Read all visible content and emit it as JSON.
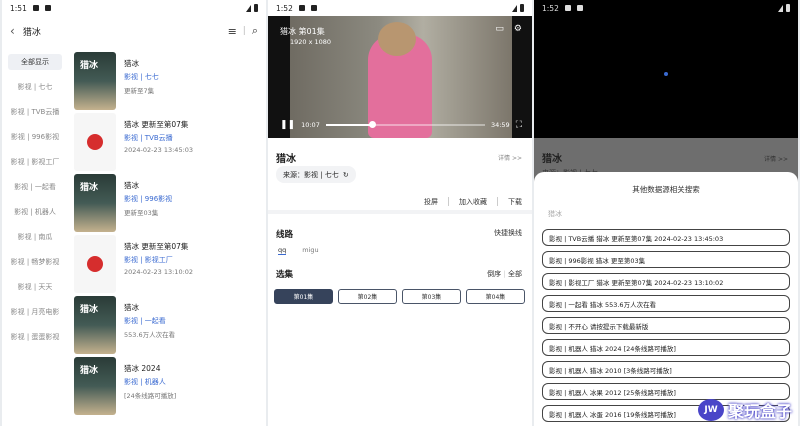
{
  "panel1": {
    "status_time": "1:51",
    "title": "猎冰",
    "sidebar": [
      "全部显示",
      "影视 | 七七",
      "影视 | TVB云播",
      "影视 | 996影视",
      "影视 | 影视工厂",
      "影视 | 一起看",
      "影视 | 机器人",
      "影视 | 南瓜",
      "影视 | 畅梦影视",
      "影视 | 天天",
      "影视 | 月亮电影",
      "影视 | 蛋蛋影视"
    ],
    "results": [
      {
        "title": "猎冰",
        "source": "影视 | 七七",
        "desc": "更新至7集",
        "poster": "movie"
      },
      {
        "title": "猎冰 更新至第07集",
        "source": "影视 | TVB云播",
        "desc": "2024-02-23 13:45:03",
        "poster": "logo"
      },
      {
        "title": "猎冰",
        "source": "影视 | 996影视",
        "desc": "更新至03集",
        "poster": "movie"
      },
      {
        "title": "猎冰 更新至第07集",
        "source": "影视 | 影视工厂",
        "desc": "2024-02-23 13:10:02",
        "poster": "logo"
      },
      {
        "title": "猎冰",
        "source": "影视 | 一起看",
        "desc": "553.6万人次在看",
        "poster": "movie"
      },
      {
        "title": "猎冰 2024",
        "source": "影视 | 机器人",
        "desc": "[24条线路可播放]",
        "poster": "movie"
      }
    ]
  },
  "panel2": {
    "status_time": "1:52",
    "video_title": "猎冰 第01集",
    "resolution": "1920 x 1080",
    "time_current": "10:07",
    "time_total": "34:59",
    "progress": 0.29,
    "title": "猎冰",
    "detail_link": "详情 >>",
    "source_label": "来源：影视 | 七七",
    "actions": [
      "投屏",
      "加入收藏",
      "下载"
    ],
    "routes_heading": "线路",
    "switch_route": "快捷换线",
    "routes": [
      "qq",
      "migu"
    ],
    "episodes_heading": "选集",
    "sort_label": "倒序",
    "all_label": "全部",
    "episodes": [
      "第01集",
      "第02集",
      "第03集",
      "第04集"
    ]
  },
  "panel3": {
    "status_time": "1:52",
    "bg_title": "猎冰",
    "bg_detail": "详情 >>",
    "bg_source": "来源：影视 | 七七",
    "sheet_title": "其他数据源相关搜索",
    "search_text": "猎冰",
    "items": [
      "影视 | TVB云播  猎冰 更新至第07集  2024-02-23 13:45:03",
      "影视 | 996影视  猎冰  更至第03集",
      "影视 | 影视工厂  猎冰 更新至第07集  2024-02-23 13:10:02",
      "影视 | 一起看  猎冰  553.6万人次在看",
      "影视 | 不开心  请按提示下载最新版",
      "影视 | 机器人  猎冰 2024  [24条线路可播放]",
      "影视 | 机器人  猎冰 2010  [3条线路可播放]",
      "影视 | 机器人  冰果 2012  [25条线路可播放]",
      "影视 | 机器人  冰蛋 2016  [19条线路可播放]"
    ]
  },
  "watermark": {
    "logo_text": "JW",
    "text": "聚玩盒子"
  }
}
